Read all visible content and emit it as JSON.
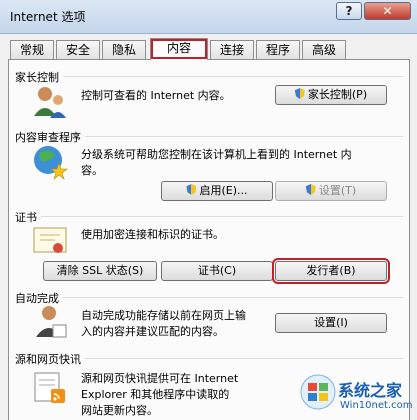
{
  "window": {
    "title": "Internet 选项",
    "help_label": "?",
    "close_label": "✕"
  },
  "tabs": [
    {
      "label": "常规"
    },
    {
      "label": "安全"
    },
    {
      "label": "隐私"
    },
    {
      "label": "内容"
    },
    {
      "label": "连接"
    },
    {
      "label": "程序"
    },
    {
      "label": "高级"
    }
  ],
  "active_tab": "内容",
  "parental": {
    "title": "家长控制",
    "desc": "控制可查看的 Internet 内容。",
    "button": "家长控制(P)"
  },
  "advisor": {
    "title": "内容审查程序",
    "desc_line1": "分级系统可帮助您控制在该计算机上看到的 Internet 内",
    "desc_line2": "容。",
    "enable_button": "启用(E)...",
    "settings_button": "设置(T)"
  },
  "certificates": {
    "title": "证书",
    "desc": "使用加密连接和标识的证书。",
    "clear_ssl_button": "清除 SSL 状态(S)",
    "certificates_button": "证书(C)",
    "publishers_button": "发行者(B)"
  },
  "autocomplete": {
    "title": "自动完成",
    "desc_line1": "自动完成功能存储以前在网页上输",
    "desc_line2": "入的内容并建议匹配的内容。",
    "settings_button": "设置(I)"
  },
  "feeds": {
    "title": "源和网页快讯",
    "desc_line1": "源和网页快讯提供可在 Internet",
    "desc_line2": "Explorer 和其他程序中读取的",
    "desc_line3": "网站更新内容。"
  },
  "watermark": {
    "main": "系统之家",
    "sub": "Win10net.com"
  },
  "colors": {
    "highlight_box": "#c0202c",
    "title_bar": "#c4d6ea",
    "panel": "#fbfbfb"
  }
}
